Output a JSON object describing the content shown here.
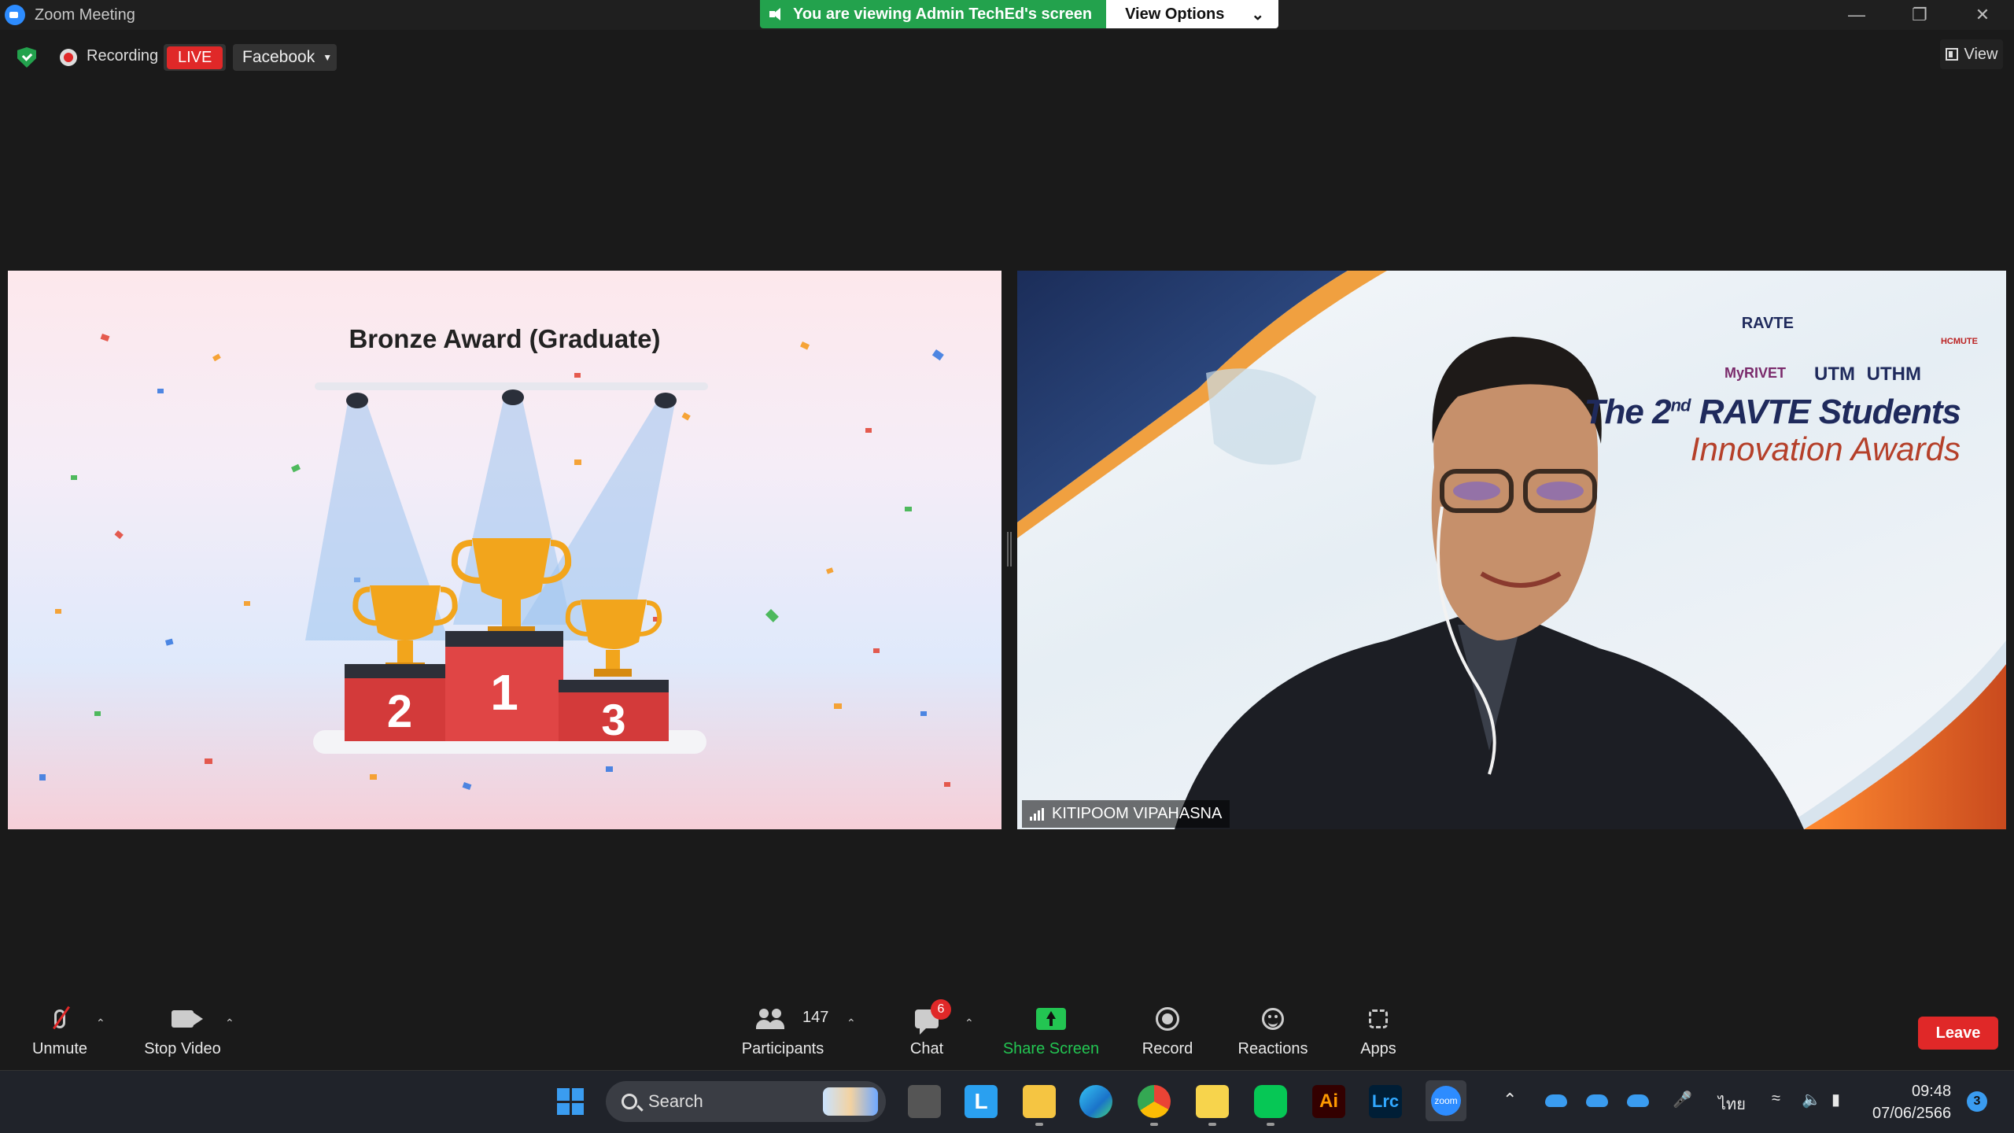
{
  "window": {
    "title": "Zoom Meeting"
  },
  "banner": {
    "message": "You are viewing Admin TechEd's screen",
    "view_options": "View Options"
  },
  "topbar": {
    "recording_label": "Recording",
    "live_label": "LIVE",
    "stream_target": "Facebook",
    "view_label": "View"
  },
  "shared_screen": {
    "slide_title": "Bronze Award (Graduate)",
    "podium_places": [
      "2",
      "1",
      "3"
    ]
  },
  "speaker_video": {
    "participant_name": "KITIPOOM VIPAHASNA",
    "awards_line1_prefix": "The 2",
    "awards_line1_sup": "nd",
    "awards_line1_suffix": " RAVTE Students",
    "awards_line2": "Innovation Awards",
    "logos": [
      "RAVTE",
      "HCMUTE",
      "MyRIVET",
      "UTM",
      "UTHM"
    ]
  },
  "toolbar": {
    "unmute": "Unmute",
    "stop_video": "Stop Video",
    "participants": "Participants",
    "participant_count": "147",
    "chat": "Chat",
    "chat_badge": "6",
    "share_screen": "Share Screen",
    "record": "Record",
    "reactions": "Reactions",
    "apps": "Apps",
    "leave": "Leave"
  },
  "taskbar": {
    "search_label": "Search",
    "tray_language": "ไทย",
    "clock_time": "09:48",
    "clock_date": "07/06/2566",
    "notification_count": "3",
    "pinned_apps": [
      "L",
      "Ai",
      "Lrc",
      "zoom"
    ]
  },
  "colors": {
    "accent_green": "#23a24d",
    "share_green": "#23c552",
    "alert_red": "#e02828",
    "zoom_blue": "#2d8cff"
  },
  "icons": [
    "zoom-logo-icon",
    "speaker-icon",
    "shield-icon",
    "record-icon",
    "mic-muted-icon",
    "camera-icon",
    "participants-icon",
    "chat-icon",
    "share-screen-icon",
    "reactions-icon",
    "apps-icon",
    "windows-start-icon",
    "search-icon"
  ]
}
